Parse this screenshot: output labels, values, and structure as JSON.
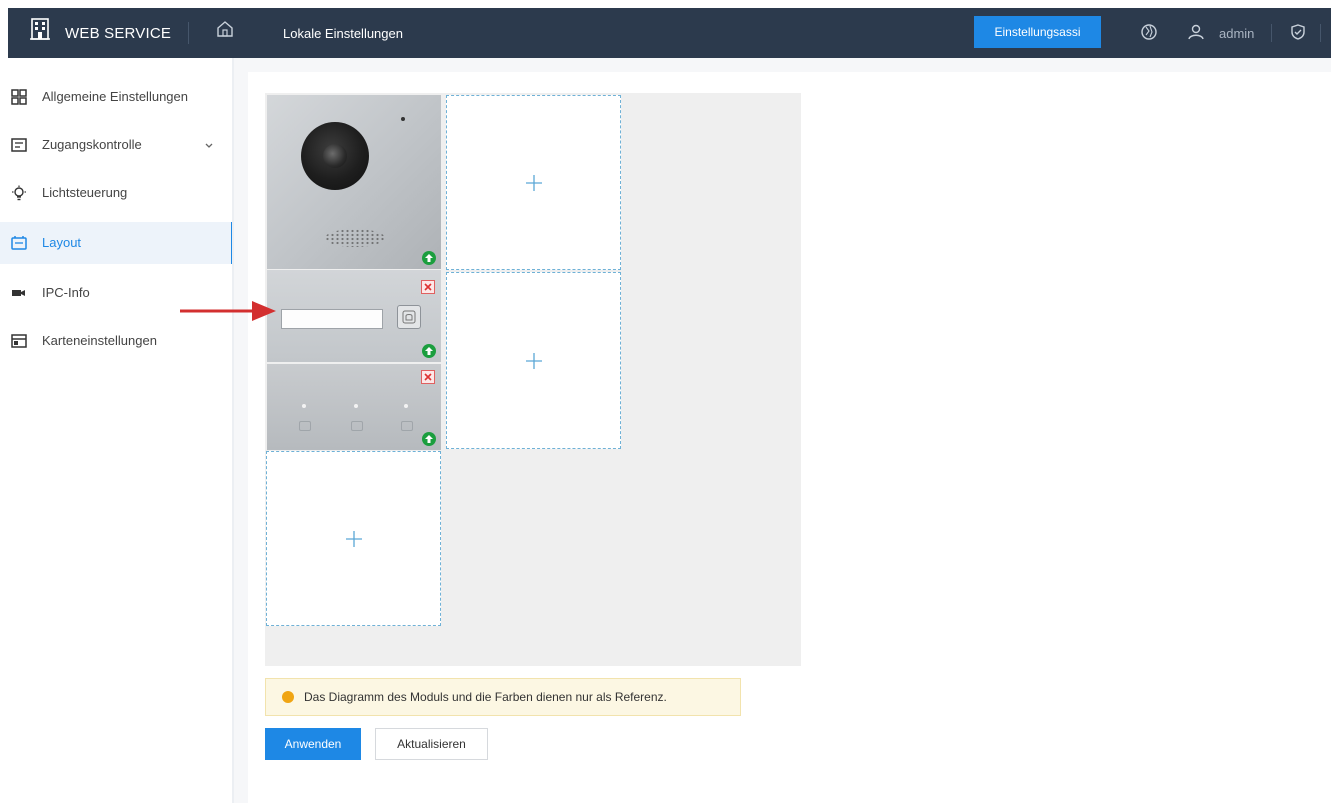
{
  "header": {
    "app_title": "WEB SERVICE",
    "page_title": "Lokale Einstellungen",
    "wizard_label": "Einstellungsassi",
    "user": "admin"
  },
  "sidebar": {
    "items": [
      {
        "label": "Allgemeine Einstellungen",
        "icon": "grid-icon"
      },
      {
        "label": "Zugangskontrolle",
        "icon": "access-control-icon"
      },
      {
        "label": "Lichtsteuerung",
        "icon": "light-bulb-icon"
      },
      {
        "label": "Layout",
        "icon": "layout-icon",
        "active": true
      },
      {
        "label": "IPC-Info",
        "icon": "camera-icon"
      },
      {
        "label": "Karteneinstellungen",
        "icon": "card-icon"
      }
    ]
  },
  "layout": {
    "modules": [
      "camera-module",
      "name-display-module",
      "keypad-module"
    ],
    "empty_slot_symbol": "+"
  },
  "notice": {
    "text": "Das Diagramm des Moduls und die Farben dienen nur als Referenz."
  },
  "actions": {
    "apply_label": "Anwenden",
    "refresh_label": "Aktualisieren"
  },
  "colors": {
    "header_bg": "#2c3a4d",
    "accent": "#1e88e5",
    "up_button": "#1b9e3e",
    "close_button_border": "#e06060",
    "notice_bg": "#fcf7e3",
    "annotation_arrow": "#d32f2f"
  }
}
